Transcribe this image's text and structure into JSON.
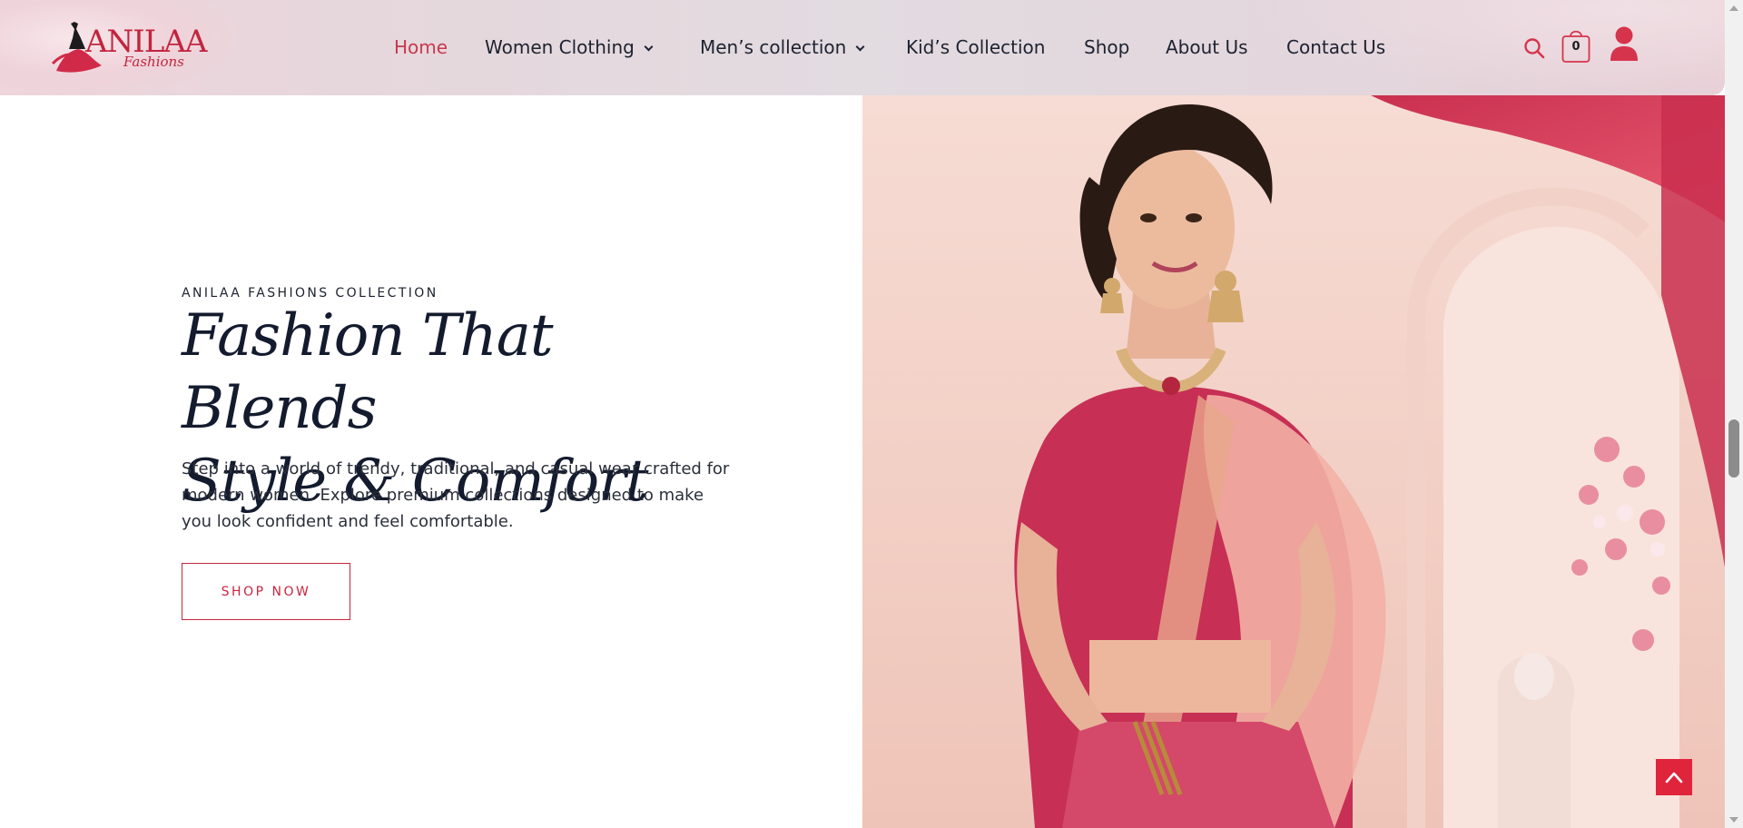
{
  "header": {
    "logo": {
      "name": "ANILAA",
      "sub": "Fashions"
    },
    "nav": [
      {
        "label": "Home",
        "active": true,
        "dropdown": false
      },
      {
        "label": "Women Clothing",
        "active": false,
        "dropdown": true
      },
      {
        "label": "Men’s collection",
        "active": false,
        "dropdown": true
      },
      {
        "label": "Kid’s Collection",
        "active": false,
        "dropdown": false
      },
      {
        "label": "Shop",
        "active": false,
        "dropdown": false
      },
      {
        "label": "About Us",
        "active": false,
        "dropdown": false
      },
      {
        "label": "Contact Us",
        "active": false,
        "dropdown": false
      }
    ],
    "cart_count": "0",
    "icons": [
      "search-icon",
      "cart-bag-icon",
      "user-account-icon"
    ]
  },
  "hero": {
    "eyebrow": "ANILAA FASHIONS COLLECTION",
    "headline_line1": "Fashion That Blends",
    "headline_line2": "Style & Comfort",
    "description": "Step into a world of trendy, traditional, and casual wear crafted for modern women. Explore premium collections designed to make you look confident and feel comfortable.",
    "cta_label": "SHOP NOW"
  },
  "colors": {
    "accent": "#c8253f",
    "nav_active": "#c8394f",
    "back_to_top": "#e0243b",
    "headline": "#141b2e"
  }
}
